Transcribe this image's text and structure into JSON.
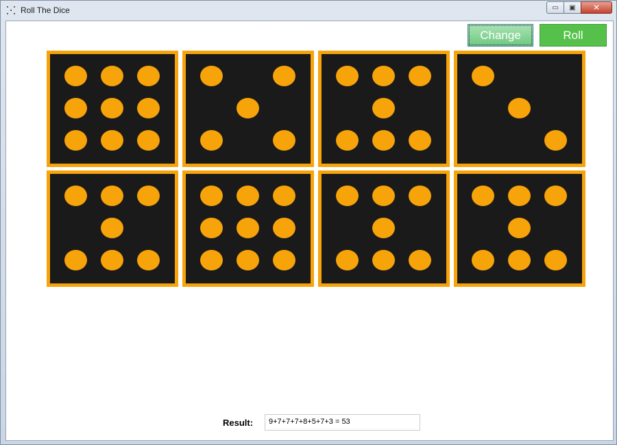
{
  "window": {
    "title": "Roll The Dice",
    "icon": "dice-dots-icon",
    "controls": [
      "minimize",
      "maximize",
      "close"
    ]
  },
  "toolbar": {
    "change_label": "Change",
    "roll_label": "Roll"
  },
  "dice": [
    9,
    5,
    7,
    3,
    7,
    9,
    7,
    7
  ],
  "colors": {
    "die_face": "#1a1a1a",
    "pip": "#f7a30a",
    "change_button": "#7fd08f",
    "roll_button": "#55c14a"
  },
  "result": {
    "label": "Result:",
    "value": "9+7+7+7+8+5+7+3 = 53"
  }
}
